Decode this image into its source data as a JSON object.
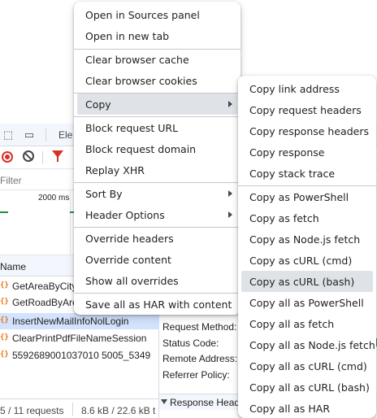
{
  "devtools": {
    "tab_elements_partial": "Ele",
    "filter_placeholder": "Filter",
    "overview_tick": "2000 ms",
    "name_column": "Name",
    "requests": [
      "GetAreaByCity",
      "GetRoadByAre",
      "InsertNewMailInfoNolLogin",
      "ClearPrintPdfFileNameSession",
      "5592689001037010 5005_5349"
    ],
    "request_headers": {
      "method_label": "Request Method:",
      "status_label": "Status Code:",
      "remote_label": "Remote Address:",
      "referrer_label": "Referrer Policy:",
      "response_section": "Response Heade"
    },
    "status_bar": {
      "requests": "5 / 11 requests",
      "transferred": "8.6 kB / 22.6 kB t"
    }
  },
  "context_menu": {
    "items": [
      "Open in Sources panel",
      "Open in new tab",
      "Clear browser cache",
      "Clear browser cookies",
      "Copy",
      "Block request URL",
      "Block request domain",
      "Replay XHR",
      "Sort By",
      "Header Options",
      "Override headers",
      "Override content",
      "Show all overrides",
      "Save all as HAR with content"
    ]
  },
  "copy_submenu": {
    "items": [
      "Copy link address",
      "Copy request headers",
      "Copy response headers",
      "Copy response",
      "Copy stack trace",
      "Copy as PowerShell",
      "Copy as fetch",
      "Copy as Node.js fetch",
      "Copy as cURL (cmd)",
      "Copy as cURL (bash)",
      "Copy all as PowerShell",
      "Copy all as fetch",
      "Copy all as Node.js fetch",
      "Copy all as cURL (cmd)",
      "Copy all as cURL (bash)",
      "Copy all as HAR"
    ]
  },
  "colors": {
    "accent_record": "#d93025",
    "xhr_icon": "#e8710a",
    "selected_row": "#d3e3fd",
    "menu_highlight": "#dfe3e8"
  }
}
